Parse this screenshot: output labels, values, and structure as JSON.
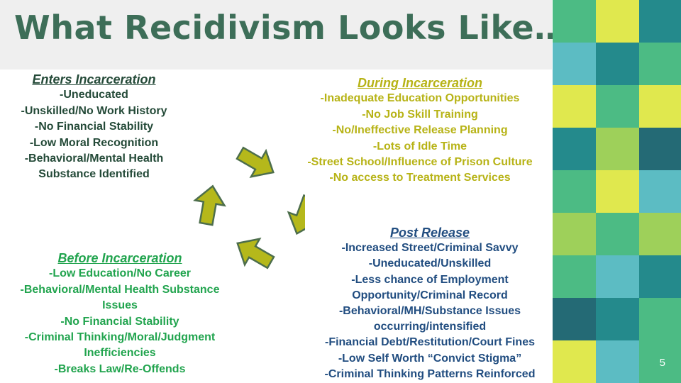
{
  "title": "What Recidivism Looks Like…",
  "page_number": "5",
  "colors": {
    "title": "#3d6e58",
    "enters": "#244a38",
    "during": "#b7b316",
    "post": "#214d80",
    "before": "#21a44e",
    "arrow_fill": "#b5b81b",
    "arrow_stroke": "#4d6e4c"
  },
  "mosaic": [
    "#4cbb84",
    "#e0e84e",
    "#248a8c",
    "#5cbcc3",
    "#248a8c",
    "#4cbb84",
    "#e0e84e",
    "#4cbb84",
    "#e0e84e",
    "#248a8c",
    "#9ed05a",
    "#246a75",
    "#4cbb84",
    "#e0e84e",
    "#5cbcc3",
    "#9ed05a",
    "#4cbb84",
    "#9ed05a",
    "#4cbb84",
    "#5cbcc3",
    "#248a8c",
    "#246a75",
    "#248a8c",
    "#4cbb84",
    "#e0e84e",
    "#5cbcc3",
    "#4cbb84"
  ],
  "enters": {
    "heading": "Enters Incarceration",
    "lines": [
      "-Uneducated",
      "-Unskilled/No Work History",
      "-No Financial Stability",
      "-Low Moral Recognition",
      "-Behavioral/Mental Health",
      "Substance Identified"
    ]
  },
  "during": {
    "heading": "During Incarceration",
    "lines": [
      "-Inadequate Education Opportunities",
      "-No Job Skill Training",
      "-No/Ineffective Release Planning",
      "-Lots of Idle Time",
      "-Street School/Influence of Prison Culture",
      "-No access to Treatment Services"
    ]
  },
  "post": {
    "heading": "Post Release",
    "lines": [
      "-Increased Street/Criminal Savvy",
      "-Uneducated/Unskilled",
      "-Less chance of Employment",
      "Opportunity/Criminal Record",
      "-Behavioral/MH/Substance Issues",
      "occurring/intensified",
      "-Financial Debt/Restitution/Court Fines",
      "-Low Self Worth  “Convict Stigma”",
      "-Criminal Thinking Patterns Reinforced"
    ]
  },
  "before": {
    "heading": "Before Incarceration",
    "lines": [
      "-Low Education/No Career",
      "-Behavioral/Mental Health Substance",
      "Issues",
      "-No Financial Stability",
      "-Criminal Thinking/Moral/Judgment",
      "Inefficiencies",
      "-Breaks Law/Re-Offends"
    ]
  }
}
